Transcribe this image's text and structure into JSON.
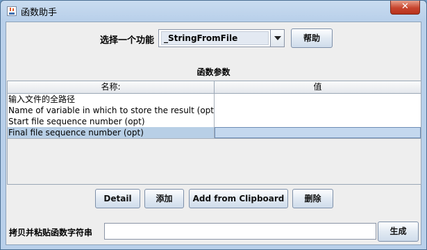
{
  "window": {
    "title": "函数助手",
    "close_label": "✕"
  },
  "function_select": {
    "label": "选择一个功能",
    "selected": "_StringFromFile"
  },
  "help_button": "帮助",
  "params": {
    "title": "函数参数",
    "headers": [
      "名称:",
      "值"
    ],
    "rows": [
      {
        "name": "输入文件的全路径",
        "value": ""
      },
      {
        "name": "Name of variable in which to store the result (optional)",
        "value": ""
      },
      {
        "name": "Start file sequence number (opt)",
        "value": ""
      },
      {
        "name": "Final file sequence number (opt)",
        "value": ""
      }
    ]
  },
  "buttons": {
    "detail": "Detail",
    "add": "添加",
    "add_from_clipboard": "Add from Clipboard",
    "delete": "删除"
  },
  "copy": {
    "label": "拷贝并粘贴函数字符串",
    "value": "",
    "generate": "生成"
  }
}
